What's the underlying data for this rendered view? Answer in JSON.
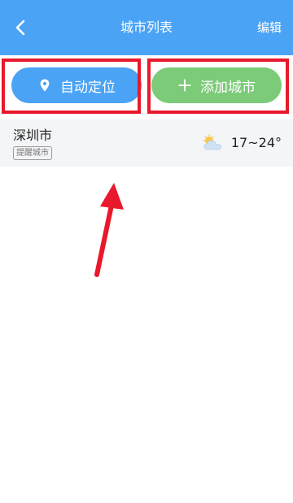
{
  "header": {
    "title": "城市列表",
    "edit_label": "编辑"
  },
  "toolbar": {
    "locate_label": "自动定位",
    "add_label": "添加城市"
  },
  "cities": [
    {
      "name": "深圳市",
      "badge": "提醒城市",
      "weather_icon": "partly-cloudy-icon",
      "temp_range": "17~24°"
    }
  ],
  "colors": {
    "header_bg": "#4aa3f5",
    "locate_bg": "#4aa3f5",
    "add_bg": "#7ccb78",
    "highlight": "#e8192c",
    "row_bg": "#f4f5f7"
  }
}
